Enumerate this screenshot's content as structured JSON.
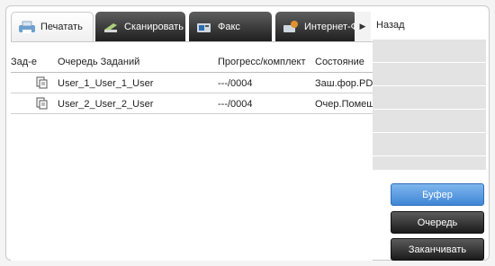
{
  "tabs": [
    {
      "label": "Печатать",
      "icon": "printer-icon",
      "active": true
    },
    {
      "label": "Сканировать",
      "icon": "scanner-icon",
      "active": false
    },
    {
      "label": "Факс",
      "icon": "fax-icon",
      "active": false
    },
    {
      "label": "Интернет-Факс",
      "icon": "internet-fax-icon",
      "active": false
    }
  ],
  "tab_scroll_icon": "play-arrow-icon",
  "table": {
    "columns": [
      "Зад-е",
      "Очередь Заданий",
      "Прогресс/комплект",
      "Состояние"
    ],
    "rows": [
      {
        "icon": "document-icon",
        "job": "User_1_User_1_User",
        "progress": "---/0004",
        "status": "Заш.фор.PDF"
      },
      {
        "icon": "document-icon",
        "job": "User_2_User_2_User",
        "progress": "---/0004",
        "status": "Очер.Помещ."
      }
    ]
  },
  "side": {
    "back": "Назад",
    "buffer": "Буфер",
    "queue": "Очередь",
    "finish": "Заканчивать"
  },
  "colors": {
    "accent_blue": "#4a8fdc",
    "dark_button": "#222222"
  }
}
